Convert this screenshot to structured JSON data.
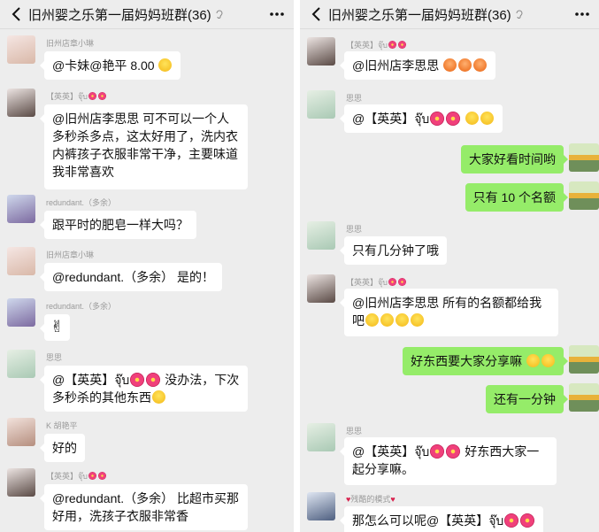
{
  "left": {
    "header": {
      "title": "旧州婴之乐第一届妈妈班群(36)"
    },
    "messages": [
      {
        "sender": "旧州店章小琳",
        "text": "@卡妹@艳平  8.00"
      },
      {
        "sender": "【英英】",
        "sender_suffix": "จุ๊บ",
        "text": "@旧州店李思思   可不可以一个人多秒杀多点，这太好用了，洗内衣内裤孩子衣服非常干净，主要味道我非常喜欢"
      },
      {
        "sender": "redundant.（多余）",
        "text": "跟平时的肥皂一样大吗？"
      },
      {
        "sender": "旧州店章小琳",
        "text": "@redundant.（多余）   是的！"
      },
      {
        "sender": "redundant.（多余）",
        "text": "✌"
      },
      {
        "sender": "思思",
        "text_prefix": "@【英英】",
        "text_suffix_word": "จุ๊บ",
        "text": "没办法，下次多秒杀的其他东西"
      },
      {
        "sender": "K 胡艳平",
        "text": "好的"
      },
      {
        "sender": "【英英】",
        "sender_suffix": "จุ๊บ",
        "text": "@redundant.（多余）   比超市买那好用，洗孩子衣服非常香"
      }
    ]
  },
  "right": {
    "header": {
      "title": "旧州婴之乐第一届妈妈班群(36)"
    },
    "messages": [
      {
        "sender": "【英英】",
        "sender_suffix": "จุ๊บ",
        "text": "@旧州店李思思"
      },
      {
        "sender": "思思",
        "text_prefix": "@【英英】",
        "text_suffix_word": "จุ๊บ"
      },
      {
        "out": true,
        "text": "大家好看时间哟"
      },
      {
        "out": true,
        "text": "只有 10 个名额"
      },
      {
        "sender": "思思",
        "text": "只有几分钟了哦"
      },
      {
        "sender": "【英英】",
        "sender_suffix": "จุ๊บ",
        "text": "@旧州店李思思   所有的名额都给我吧"
      },
      {
        "out": true,
        "text": "好东西要大家分享嘛"
      },
      {
        "out": true,
        "text": "还有一分钟"
      },
      {
        "sender": "思思",
        "text_prefix": "@【英英】",
        "text_suffix_word": "จุ๊บ",
        "text": "好东西大家一起分享嘛。"
      },
      {
        "sender": "残酷的模式",
        "text_prefix": "那怎么可以呢@【英英】",
        "text_suffix_word": "จุ๊บ"
      }
    ]
  },
  "colors": {
    "background": "#ededed",
    "bubble_in": "#ffffff",
    "bubble_out": "#95ec69"
  }
}
